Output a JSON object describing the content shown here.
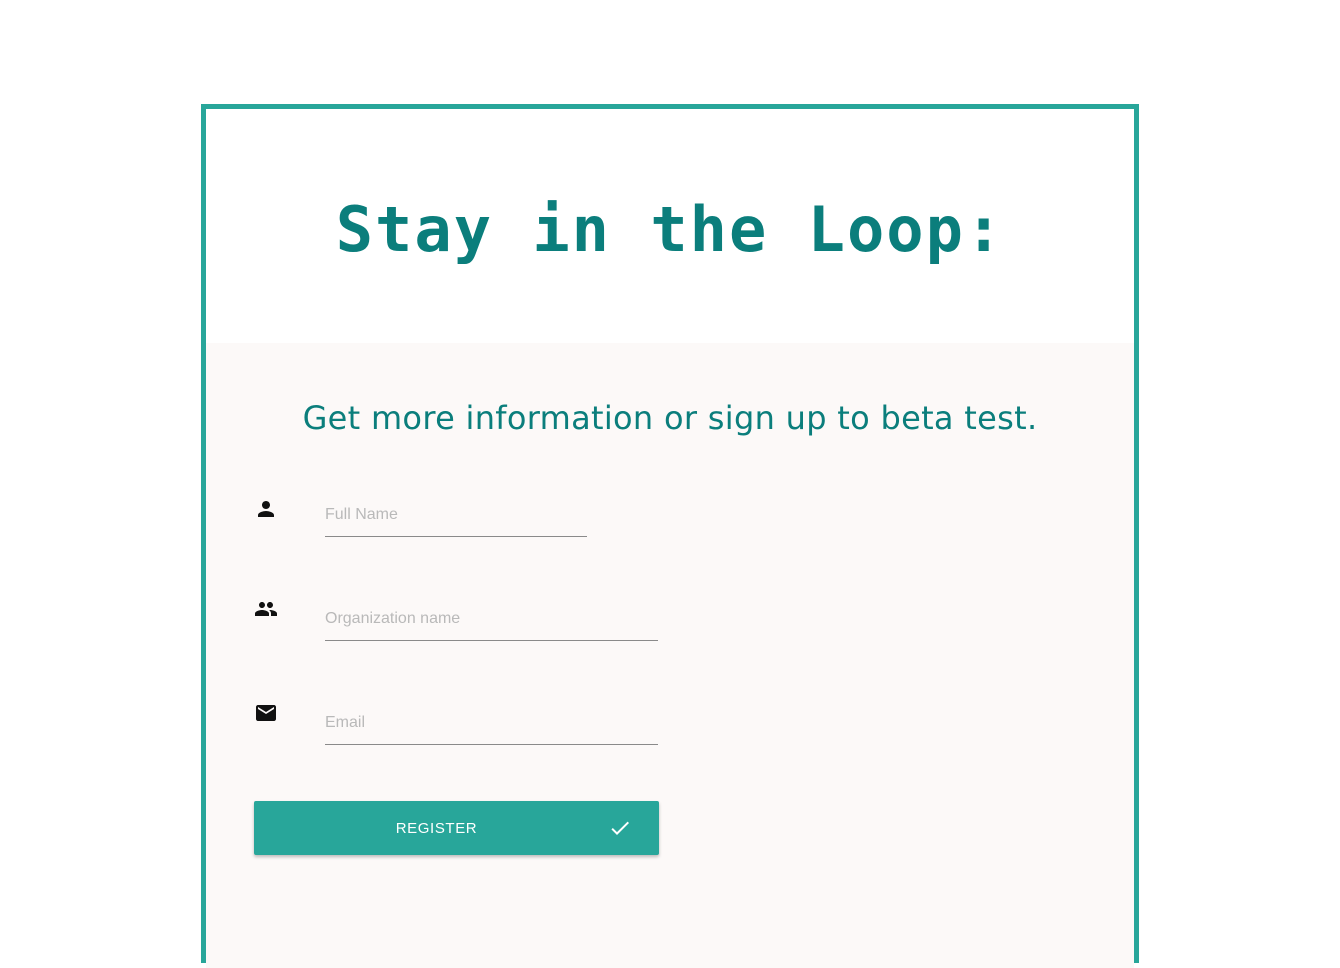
{
  "header": {
    "title": "Stay in the Loop:"
  },
  "form": {
    "subtitle": "Get more information or sign up to beta test.",
    "fields": [
      {
        "icon": "person-icon",
        "placeholder": "Full Name",
        "value": ""
      },
      {
        "icon": "group-icon",
        "placeholder": "Organization name",
        "value": ""
      },
      {
        "icon": "mail-icon",
        "placeholder": "Email",
        "value": ""
      }
    ],
    "submit": {
      "label": "REGISTER",
      "icon": "check-icon"
    }
  },
  "colors": {
    "accent": "#28a69a",
    "title_text": "#0b7e7c",
    "body_background": "#fcf9f8"
  }
}
